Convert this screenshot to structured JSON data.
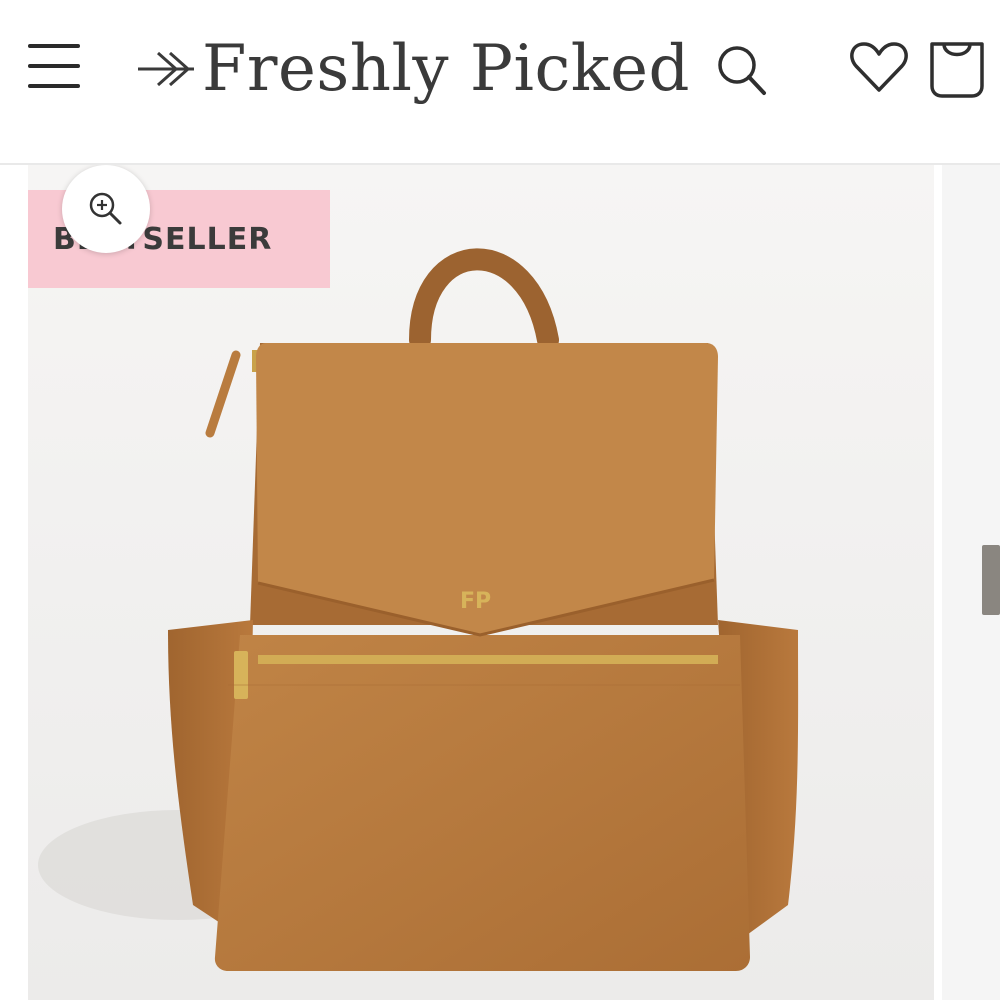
{
  "header": {
    "brand": "Freshly Picked",
    "icons": {
      "menu": "hamburger-menu-icon",
      "logo_mark": "arrow-logo-icon",
      "search": "search-icon",
      "wishlist": "heart-icon",
      "cart": "shopping-bag-icon"
    }
  },
  "product": {
    "badge": "BESTSELLER",
    "zoom_icon": "zoom-in-icon",
    "logo_plate": "FP"
  },
  "colors": {
    "badge_bg": "#f8c9d2",
    "leather": "#b87a3d",
    "hardware": "#d7b35a",
    "text": "#3a3a3a"
  }
}
